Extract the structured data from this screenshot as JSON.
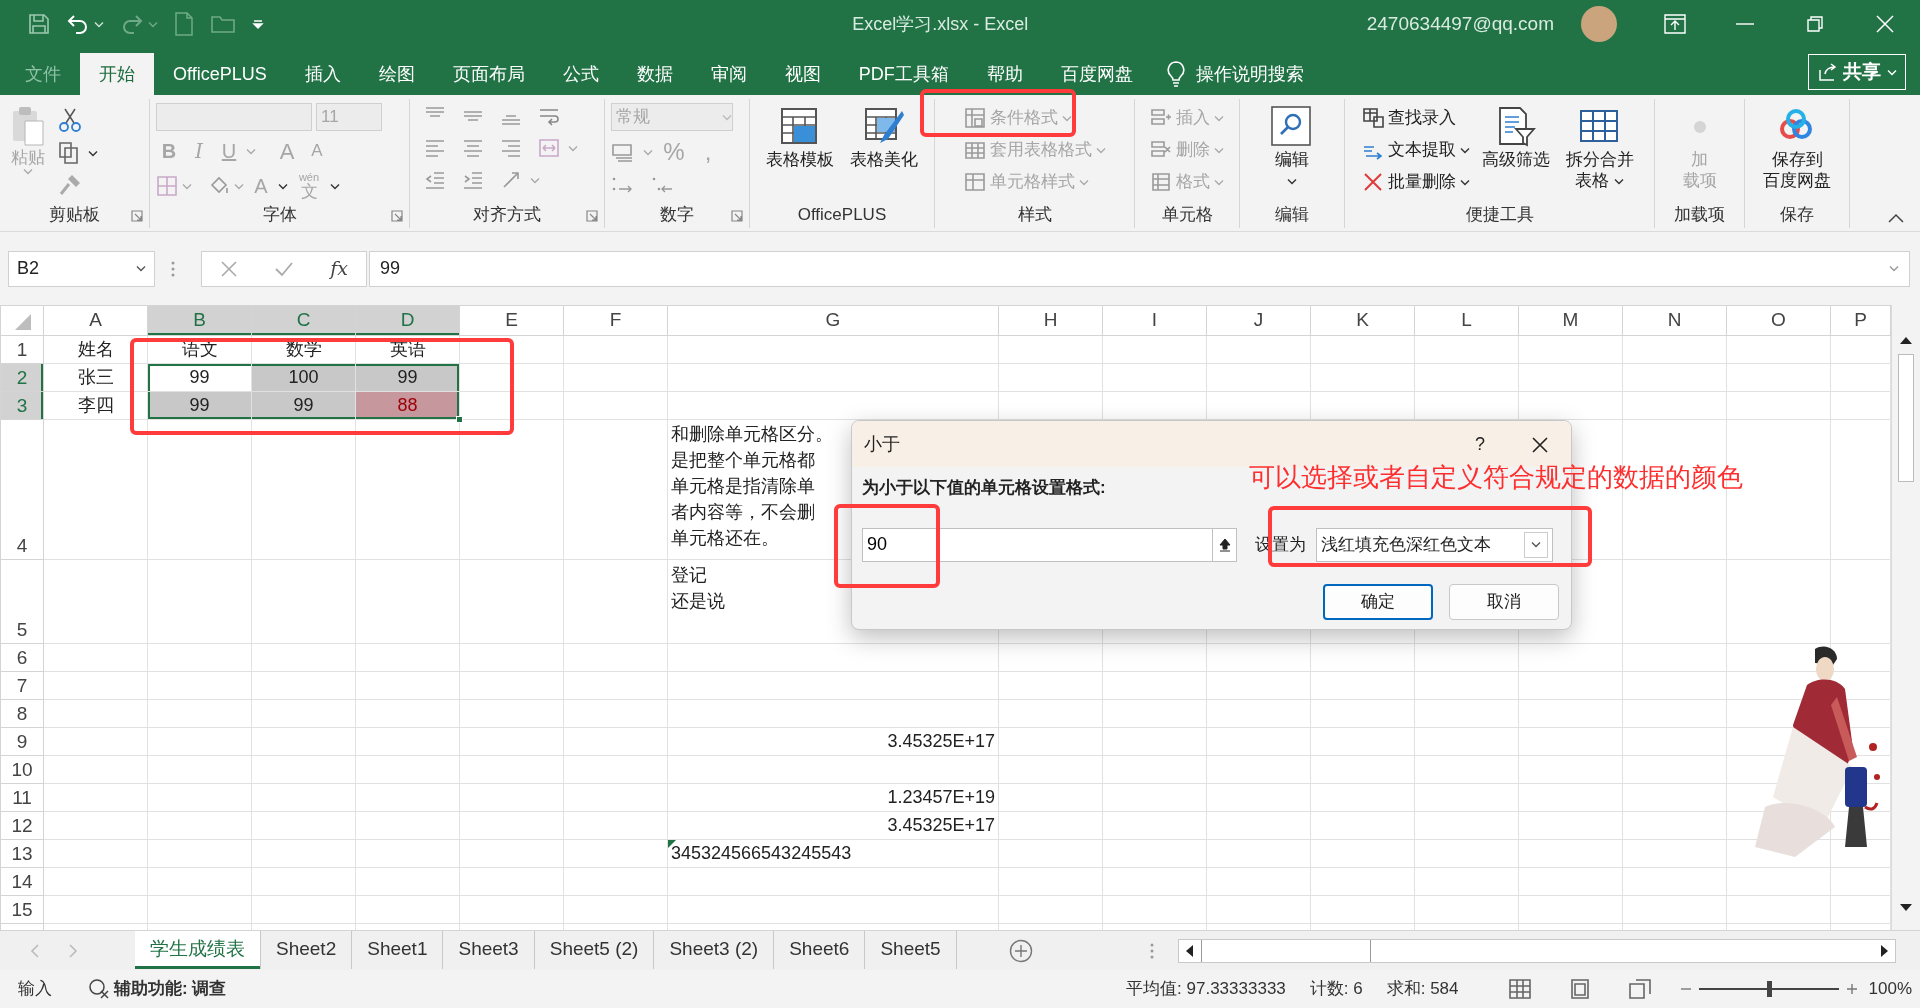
{
  "title_bar": {
    "title": "Excel学习.xlsx - Excel",
    "account": "2470634497@qq.com"
  },
  "menu_tabs": [
    {
      "label": "文件",
      "kind": "file",
      "selected": false
    },
    {
      "label": "开始",
      "kind": "tab",
      "selected": true
    },
    {
      "label": "OfficePLUS",
      "kind": "tab",
      "selected": false
    },
    {
      "label": "插入",
      "kind": "tab",
      "selected": false
    },
    {
      "label": "绘图",
      "kind": "tab",
      "selected": false
    },
    {
      "label": "页面布局",
      "kind": "tab",
      "selected": false
    },
    {
      "label": "公式",
      "kind": "tab",
      "selected": false
    },
    {
      "label": "数据",
      "kind": "tab",
      "selected": false
    },
    {
      "label": "审阅",
      "kind": "tab",
      "selected": false
    },
    {
      "label": "视图",
      "kind": "tab",
      "selected": false
    },
    {
      "label": "PDF工具箱",
      "kind": "tab",
      "selected": false
    },
    {
      "label": "帮助",
      "kind": "tab",
      "selected": false
    },
    {
      "label": "百度网盘",
      "kind": "tab",
      "selected": false
    }
  ],
  "tell_me": "操作说明搜索",
  "share_button": "共享",
  "ribbon": {
    "groups": [
      {
        "kind": "clipboard",
        "label": "剪贴板",
        "paste": {
          "label": "粘贴",
          "disabled": true
        }
      },
      {
        "kind": "font",
        "label": "字体",
        "disabled": true,
        "font_size": "11",
        "glyphs": [
          {
            "text": "B",
            "kind": "bold"
          },
          {
            "text": "I",
            "kind": "italic"
          },
          {
            "text": "U",
            "kind": "underline"
          },
          {
            "text": "A",
            "kind": "grow"
          },
          {
            "text": "A",
            "kind": "shrink"
          },
          {
            "text": "A",
            "kind": "color"
          }
        ],
        "phonetic": {
          "ruby": "wén",
          "base": "文"
        }
      },
      {
        "kind": "alignment",
        "label": "对齐方式"
      },
      {
        "kind": "number",
        "label": "数字",
        "format": "常规",
        "glyphs": [
          "%",
          ","
        ]
      },
      {
        "kind": "buttons",
        "label": "OfficePLUS",
        "items": [
          {
            "kind": "large",
            "lines": [
              "表格模板"
            ],
            "disabled": false,
            "dropdown": false
          },
          {
            "kind": "large",
            "lines": [
              "表格美化"
            ],
            "disabled": false,
            "dropdown": false
          }
        ]
      },
      {
        "kind": "buttons",
        "label": "样式",
        "items": [
          {
            "kind": "small",
            "lines": [
              "条件格式"
            ],
            "disabled": true,
            "dropdown": true
          },
          {
            "kind": "small",
            "lines": [
              "套用表格格式"
            ],
            "disabled": true,
            "dropdown": true
          },
          {
            "kind": "small",
            "lines": [
              "单元格样式"
            ],
            "disabled": true,
            "dropdown": true
          }
        ]
      },
      {
        "kind": "buttons",
        "label": "单元格",
        "items": [
          {
            "kind": "small",
            "lines": [
              "插入"
            ],
            "disabled": true,
            "dropdown": true
          },
          {
            "kind": "small",
            "lines": [
              "删除"
            ],
            "disabled": true,
            "dropdown": true
          },
          {
            "kind": "small",
            "lines": [
              "格式"
            ],
            "disabled": true,
            "dropdown": true
          }
        ]
      },
      {
        "kind": "buttons",
        "label": "编辑",
        "items": [
          {
            "kind": "large",
            "lines": [
              "编辑"
            ],
            "disabled": false,
            "dropdown": true
          }
        ]
      },
      {
        "kind": "buttons",
        "label": "便捷工具",
        "items": [
          {
            "kind": "small",
            "lines": [
              "查找录入"
            ],
            "disabled": false,
            "dropdown": false
          },
          {
            "kind": "small",
            "lines": [
              "文本提取"
            ],
            "disabled": false,
            "dropdown": true
          },
          {
            "kind": "small",
            "lines": [
              "批量删除"
            ],
            "disabled": false,
            "dropdown": true
          },
          {
            "kind": "large",
            "lines": [
              "高级筛选"
            ],
            "disabled": false,
            "dropdown": false
          },
          {
            "kind": "large",
            "lines": [
              "拆分合并",
              "表格"
            ],
            "disabled": false,
            "dropdown": true
          }
        ]
      },
      {
        "kind": "buttons",
        "label": "加载项",
        "items": [
          {
            "kind": "large",
            "lines": [
              "加",
              "载项"
            ],
            "disabled": true,
            "dropdown": false
          }
        ]
      },
      {
        "kind": "buttons",
        "label": "保存",
        "items": [
          {
            "kind": "large",
            "lines": [
              "保存到",
              "百度网盘"
            ],
            "disabled": false,
            "dropdown": false
          }
        ]
      }
    ]
  },
  "formula_bar": {
    "name_box": "B2",
    "function_label": "fx",
    "formula": "99"
  },
  "sheet": {
    "columns": [
      {
        "label": "A",
        "selected": false
      },
      {
        "label": "B",
        "selected": true
      },
      {
        "label": "C",
        "selected": true
      },
      {
        "label": "D",
        "selected": true
      },
      {
        "label": "E",
        "selected": false
      },
      {
        "label": "F",
        "selected": false
      },
      {
        "label": "G",
        "selected": false
      },
      {
        "label": "H",
        "selected": false
      },
      {
        "label": "I",
        "selected": false
      },
      {
        "label": "J",
        "selected": false
      },
      {
        "label": "K",
        "selected": false
      },
      {
        "label": "L",
        "selected": false
      },
      {
        "label": "M",
        "selected": false
      },
      {
        "label": "N",
        "selected": false
      },
      {
        "label": "O",
        "selected": false
      },
      {
        "label": "P",
        "selected": false
      }
    ],
    "rows": [
      {
        "label": "1",
        "selected": false,
        "cells": [
          {
            "text": "姓名",
            "kind": "center",
            "selected": false,
            "highlighted": false
          },
          {
            "text": "语文",
            "kind": "center",
            "selected": false,
            "highlighted": false
          },
          {
            "text": "数学",
            "kind": "center",
            "selected": false,
            "highlighted": false
          },
          {
            "text": "英语",
            "kind": "center",
            "selected": false,
            "highlighted": false
          }
        ]
      },
      {
        "label": "2",
        "selected": true,
        "cells": [
          {
            "text": "张三",
            "kind": "center",
            "selected": false,
            "highlighted": false
          },
          {
            "text": "99",
            "kind": "center",
            "selected": true,
            "highlighted": false
          },
          {
            "text": "100",
            "kind": "center",
            "selected": true,
            "highlighted": false
          },
          {
            "text": "99",
            "kind": "center",
            "selected": true,
            "highlighted": false
          }
        ]
      },
      {
        "label": "3",
        "selected": true,
        "cells": [
          {
            "text": "李四",
            "kind": "center",
            "selected": false,
            "highlighted": false
          },
          {
            "text": "99",
            "kind": "center",
            "selected": true,
            "highlighted": false
          },
          {
            "text": "99",
            "kind": "center",
            "selected": true,
            "highlighted": false
          },
          {
            "text": "88",
            "kind": "center",
            "selected": true,
            "highlighted": true
          }
        ]
      },
      {
        "label": "4",
        "selected": false,
        "cells": [
          null,
          null,
          null,
          null,
          null,
          null,
          {
            "lines": [
              "和删除单元格区分。",
              "是把整个单元格都",
              "单元格是指清除单",
              "者内容等，不会删",
              "单元格还在。"
            ],
            "kind": "bottom",
            "selected": false,
            "highlighted": false
          }
        ]
      },
      {
        "label": "5",
        "selected": false,
        "cells": [
          null,
          null,
          null,
          null,
          null,
          null,
          {
            "lines": [
              "登记",
              "还是说"
            ],
            "kind": "top",
            "selected": false,
            "highlighted": false
          }
        ]
      },
      {
        "label": "6",
        "selected": false
      },
      {
        "label": "7",
        "selected": false
      },
      {
        "label": "8",
        "selected": false
      },
      {
        "label": "9",
        "selected": false,
        "cells": [
          null,
          null,
          null,
          null,
          null,
          null,
          {
            "text": "3.45325E+17",
            "kind": "right",
            "selected": false,
            "highlighted": false
          }
        ]
      },
      {
        "label": "10",
        "selected": false
      },
      {
        "label": "11",
        "selected": false,
        "cells": [
          null,
          null,
          null,
          null,
          null,
          null,
          {
            "text": "1.23457E+19",
            "kind": "right",
            "selected": false,
            "highlighted": false
          }
        ]
      },
      {
        "label": "12",
        "selected": false,
        "cells": [
          null,
          null,
          null,
          null,
          null,
          null,
          {
            "text": "3.45325E+17",
            "kind": "right",
            "selected": false,
            "highlighted": false
          }
        ]
      },
      {
        "label": "13",
        "selected": false,
        "cells": [
          null,
          null,
          null,
          null,
          null,
          null,
          {
            "text": "345324566543245543",
            "kind": "flagged",
            "selected": false,
            "highlighted": false
          }
        ]
      },
      {
        "label": "14",
        "selected": false
      },
      {
        "label": "15",
        "selected": false
      }
    ]
  },
  "sheet_tabs": [
    {
      "label": "学生成绩表",
      "selected": true
    },
    {
      "label": "Sheet2",
      "selected": false
    },
    {
      "label": "Sheet1",
      "selected": false
    },
    {
      "label": "Sheet3",
      "selected": false
    },
    {
      "label": "Sheet5 (2)",
      "selected": false
    },
    {
      "label": "Sheet3 (2)",
      "selected": false
    },
    {
      "label": "Sheet6",
      "selected": false
    },
    {
      "label": "Sheet5",
      "selected": false
    }
  ],
  "status_bar": {
    "mode": "输入",
    "accessibility": "辅助功能: 调查",
    "average": "平均值: 97.33333333",
    "count": "计数: 6",
    "sum": "求和: 584",
    "zoom": {
      "level": 0.5,
      "label": "100%"
    }
  },
  "dialog": {
    "title": "小于",
    "help": "?",
    "prompt": "为小于以下值的单元格设置格式:",
    "value": "90",
    "set_label": "设置为",
    "format": "浅红填充色深红色文本",
    "buttons": [
      {
        "label": "确定",
        "default": true
      },
      {
        "label": "取消",
        "default": false
      }
    ]
  },
  "annotation": "可以选择或者自定义符合规定的数据的颜色"
}
